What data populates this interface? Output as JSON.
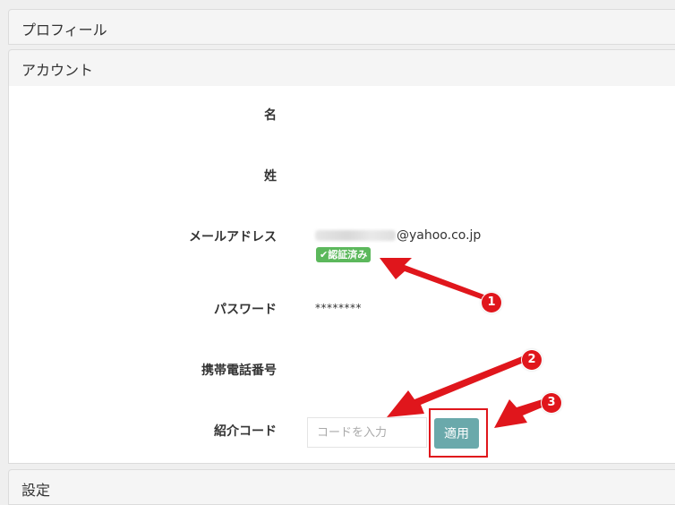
{
  "sections": {
    "profile": "プロフィール",
    "account": "アカウント",
    "settings": "設定"
  },
  "account": {
    "fields": {
      "first_name_label": "名",
      "last_name_label": "姓",
      "email_label": "メールアドレス",
      "password_label": "パスワード",
      "phone_label": "携帯電話番号",
      "referral_label": "紹介コード"
    },
    "email_domain": "@yahoo.co.jp",
    "verified_badge": "✔認証済み",
    "password_mask": "********",
    "referral_placeholder": "コードを入力",
    "apply_button": "適用"
  },
  "annotations": {
    "callout_1": "1",
    "callout_2": "2",
    "callout_3": "3"
  },
  "colors": {
    "annotation_red": "#e0161c",
    "verified_green": "#5cb85c",
    "apply_teal": "#6aa9ab"
  }
}
